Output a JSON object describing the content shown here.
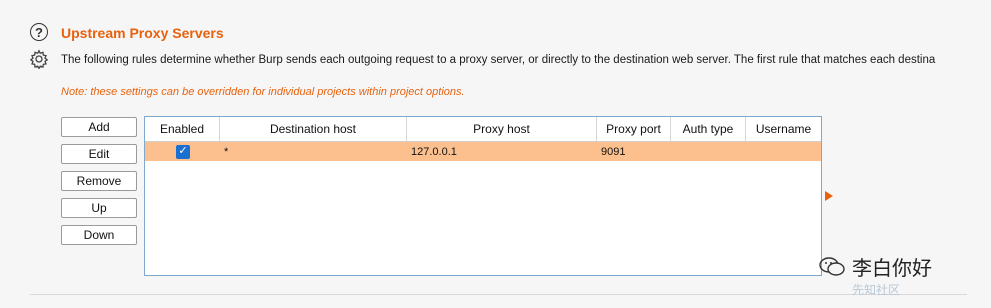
{
  "section": {
    "title": "Upstream Proxy Servers",
    "description": "The following rules determine whether Burp sends each outgoing request to a proxy server, or directly to the destination web server. The first rule that matches each destina",
    "note": "Note: these settings can be overridden for individual projects within project options."
  },
  "buttons": {
    "add": "Add",
    "edit": "Edit",
    "remove": "Remove",
    "up": "Up",
    "down": "Down"
  },
  "table": {
    "headers": [
      "Enabled",
      "Destination host",
      "Proxy host",
      "Proxy port",
      "Auth type",
      "Username"
    ],
    "rows": [
      {
        "enabled": true,
        "checkmark": "✓",
        "destination_host": "*",
        "proxy_host": "127.0.0.1",
        "proxy_port": "9091",
        "auth_type": "",
        "username": ""
      }
    ]
  },
  "watermark": {
    "text": "李白你好",
    "sub": "先知社区"
  },
  "colors": {
    "accent": "#e8620d",
    "selected_row": "#fcc08e",
    "checkbox": "#1a6fd1"
  }
}
